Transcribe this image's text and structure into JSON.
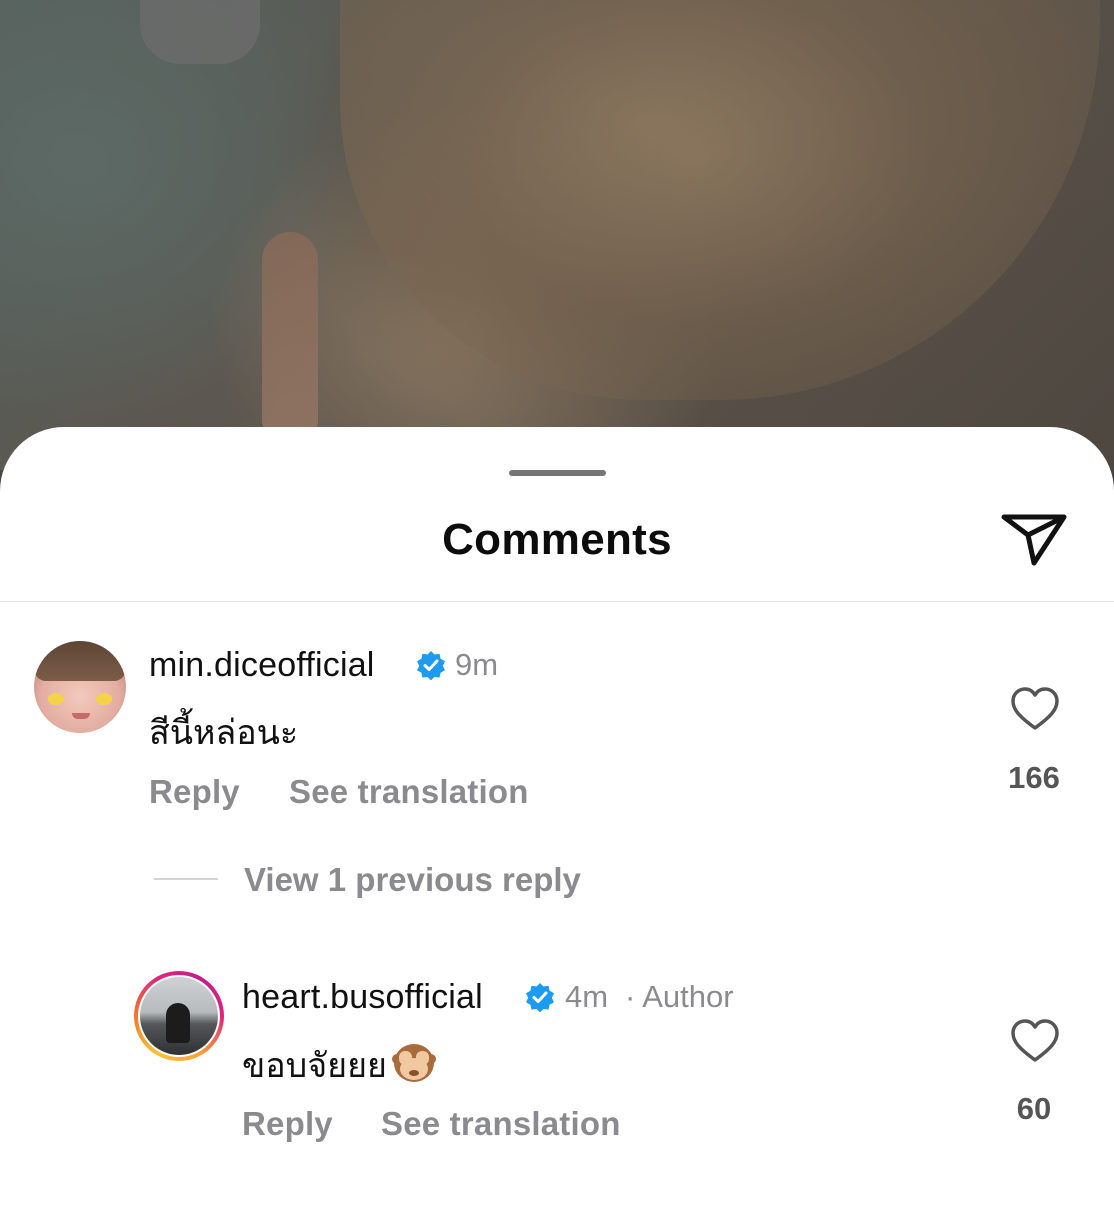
{
  "header": {
    "title": "Comments"
  },
  "comments": [
    {
      "username": "min.diceofficial",
      "time": "9m",
      "text": "สีนี้หล่อนะ",
      "reply_label": "Reply",
      "translate_label": "See translation",
      "likes": "166"
    }
  ],
  "replies_toggle": "View 1 previous reply",
  "replies": [
    {
      "username": "heart.busofficial",
      "time": "4m",
      "author_tag": "· Author",
      "text": "ขอบจัยยย",
      "emoji": "see-no-evil-monkey",
      "reply_label": "Reply",
      "translate_label": "See translation",
      "likes": "60"
    }
  ],
  "colors": {
    "verified": "#1d9bf0",
    "secondary_text": "#8b8b8f",
    "primary_text": "#111111"
  }
}
